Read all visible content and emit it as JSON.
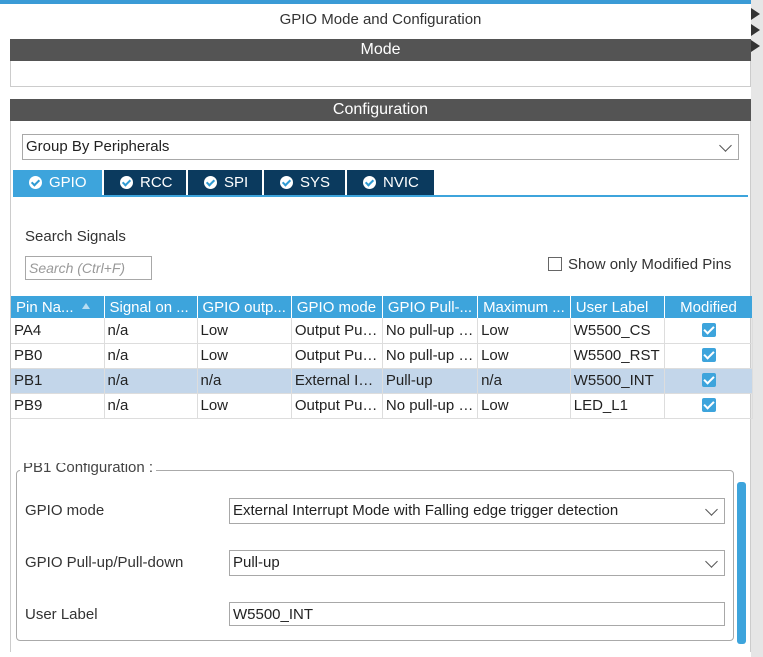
{
  "title": "GPIO Mode and Configuration",
  "sections": {
    "mode": "Mode",
    "configuration": "Configuration"
  },
  "group_by": {
    "value": "Group By Peripherals"
  },
  "tabs": [
    {
      "label": "GPIO",
      "active": true
    },
    {
      "label": "RCC",
      "active": false
    },
    {
      "label": "SPI",
      "active": false
    },
    {
      "label": "SYS",
      "active": false
    },
    {
      "label": "NVIC",
      "active": false
    }
  ],
  "search": {
    "label": "Search Signals",
    "placeholder": "Search (Ctrl+F)"
  },
  "show_modified": {
    "label": "Show only Modified Pins",
    "checked": false
  },
  "table": {
    "headers": [
      "Pin Na...",
      "Signal on ...",
      "GPIO outp...",
      "GPIO mode",
      "GPIO Pull-...",
      "Maximum ...",
      "User Label",
      "Modified"
    ],
    "rows": [
      {
        "pin": "PA4",
        "signal": "n/a",
        "output": "Low",
        "mode": "Output Push Pull",
        "pull": "No pull-up and no pull-down",
        "speed": "Low",
        "label": "W5500_CS",
        "modified": true,
        "selected": false
      },
      {
        "pin": "PB0",
        "signal": "n/a",
        "output": "Low",
        "mode": "Output Push Pull",
        "pull": "No pull-up and no pull-down",
        "speed": "Low",
        "label": "W5500_RST",
        "modified": true,
        "selected": false
      },
      {
        "pin": "PB1",
        "signal": "n/a",
        "output": "n/a",
        "mode": "External Interrupt Mode",
        "pull": "Pull-up",
        "speed": "n/a",
        "label": "W5500_INT",
        "modified": true,
        "selected": true
      },
      {
        "pin": "PB9",
        "signal": "n/a",
        "output": "Low",
        "mode": "Output Push Pull",
        "pull": "No pull-up and no pull-down",
        "speed": "Low",
        "label": "LED_L1",
        "modified": true,
        "selected": false
      }
    ]
  },
  "pin_config": {
    "legend": "PB1 Configuration :",
    "gpio_mode_label": "GPIO mode",
    "gpio_mode_value": "External Interrupt Mode with Falling edge trigger detection",
    "pull_label": "GPIO Pull-up/Pull-down",
    "pull_value": "Pull-up",
    "user_label_label": "User Label",
    "user_label_value": "W5500_INT"
  },
  "colors": {
    "accent": "#3da4dc",
    "tab_dark": "#0b3a5e",
    "section_bar": "#545454",
    "selected_row": "#c3d6ea"
  }
}
